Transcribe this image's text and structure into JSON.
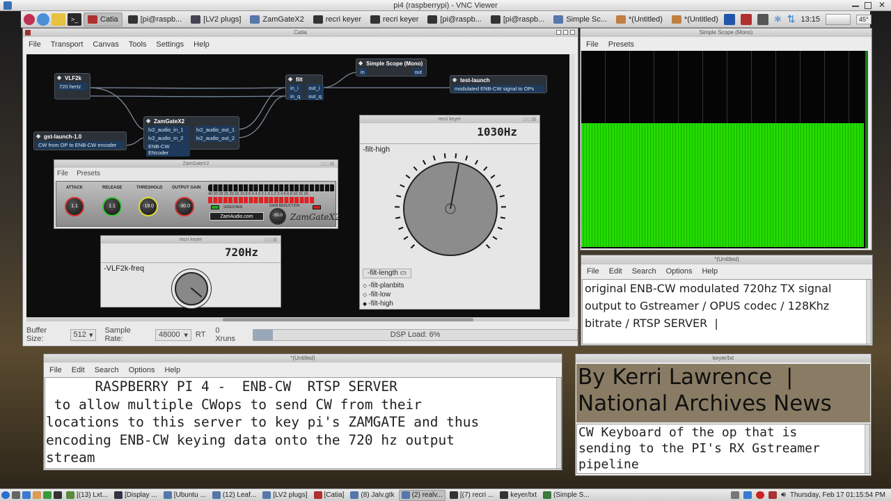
{
  "vnc_title": "pi4 (raspberrypi) - VNC Viewer",
  "top_taskbar": {
    "apps": [
      {
        "label": "Catia",
        "icon": "catia-icon",
        "color": "#b03030"
      },
      {
        "label": "[pi@raspb...",
        "icon": "terminal-icon",
        "color": "#333"
      },
      {
        "label": "[LV2 plugs]",
        "icon": "lv2-icon",
        "color": "#445"
      },
      {
        "label": "ZamGateX2",
        "icon": "window-icon",
        "color": "#5577aa"
      },
      {
        "label": "recri keyer",
        "icon": "app-icon",
        "color": "#333"
      },
      {
        "label": "recri keyer",
        "icon": "app-icon",
        "color": "#333"
      },
      {
        "label": "[pi@raspb...",
        "icon": "terminal-icon",
        "color": "#333"
      },
      {
        "label": "[pi@raspb...",
        "icon": "terminal-icon",
        "color": "#333"
      },
      {
        "label": "Simple Sc...",
        "icon": "window-icon",
        "color": "#5577aa"
      },
      {
        "label": "*(Untitled)",
        "icon": "pencil-icon",
        "color": "#c08040"
      },
      {
        "label": "*(Untitled)",
        "icon": "pencil-icon",
        "color": "#c08040"
      }
    ],
    "clock": "13:15",
    "cpu": "45°"
  },
  "catia": {
    "title": "Catia",
    "menu": [
      "File",
      "Transport",
      "Canvas",
      "Tools",
      "Settings",
      "Help"
    ],
    "nodes": {
      "vlf": {
        "title": "VLF2k",
        "port": "720 hertz"
      },
      "filt": {
        "title": "filt",
        "in_i": "in_i",
        "in_q": "in_q",
        "out_i": "out_i",
        "out_q": "out_q"
      },
      "scope": {
        "title": "Simple Scope (Mono)",
        "in": "in",
        "out": "out"
      },
      "test": {
        "title": "test-launch",
        "port": "modulated ENB-CW signal to OPs"
      },
      "zam": {
        "title": "ZamGateX2",
        "in1": "lv2_audio_in_1",
        "in2": "lv2_audio_in_2",
        "out1": "lv2_audio_out_1",
        "out2": "lv2_audio_out_2",
        "enc": "ENB-CW ENcoder"
      },
      "gst": {
        "title": "gst-launch-1.0",
        "port": "CW from OP to ENB-CW encoder"
      }
    },
    "status": {
      "buffer_label": "Buffer Size:",
      "buffer": "512",
      "rate_label": "Sample Rate:",
      "rate": "48000",
      "rt": "RT",
      "xruns": "0 Xruns",
      "dsp": "DSP Load: 6%",
      "dsp_level": 0.06
    }
  },
  "zamgate": {
    "title": "ZamGateX2",
    "menu": [
      "File",
      "Presets"
    ],
    "labels": [
      "ATTACK",
      "RELEASE",
      "THRESHOLD",
      "OUTPUT GAIN"
    ],
    "values": [
      "1.1",
      "1.1",
      "-19.0",
      "-30.0",
      "-50.0"
    ],
    "meter_scale": "40 30 28 25 20 15 10 8 6 5 4 3 2 1 0 1 2 3 4 5 6 8 10 15 20",
    "sidechain": "SIDECHAIN",
    "gain_red": "GAIN REDUCTION",
    "brand": "ZamAudio.com",
    "logo": "ZamGateX2",
    "knob_ticks": [
      "0.1",
      "500",
      "0.1",
      "500",
      "-60",
      "0",
      "-30",
      "30"
    ]
  },
  "keyer_small": {
    "title": "recri keyer",
    "freq": "720Hz",
    "param": "-VLF2k-freq"
  },
  "keyer_big": {
    "title": "recri keyer",
    "freq": "1030Hz",
    "param": "-filt-high",
    "select": "-filt-length",
    "options": [
      "-filt-planbits",
      "-filt-low",
      "-filt-high"
    ]
  },
  "scope_win": {
    "title": "Simple Scope (Mono)",
    "menu": [
      "File",
      "Presets"
    ]
  },
  "editor_top": {
    "title": "*(Untitled)",
    "menu": [
      "File",
      "Edit",
      "Search",
      "Options",
      "Help"
    ],
    "lines": [
      "original ENB-CW modulated 720hz TX signal",
      "output to Gstreamer / OPUS codec / 128Khz",
      "bitrate / RTSP SERVER  |"
    ]
  },
  "editor_main": {
    "title": "*(Untitled)",
    "menu": [
      "File",
      "Edit",
      "Search",
      "Options",
      "Help"
    ],
    "lines": [
      "      RASPBERRY PI 4 -  ENB-CW  RTSP SERVER",
      " to allow multiple CWops to send CW from their",
      "locations to this server to key pi's ZAMGATE and thus",
      "encoding ENB-CW keying data onto the 720 hz output",
      "stream"
    ]
  },
  "keyer_txt": {
    "title": "keyer/txt",
    "banner": [
      "By Kerri Lawrence  |",
      "National Archives News"
    ],
    "lines": [
      "CW Keyboard of the op that is",
      "sending to the PI's RX Gstreamer",
      "pipeline"
    ]
  },
  "bottom_taskbar": {
    "apps": [
      {
        "label": "[(13) Lxt...",
        "color": "#5a8a3a"
      },
      {
        "label": "[Display ...",
        "color": "#334"
      },
      {
        "label": "[Ubuntu ...",
        "color": "#5577aa"
      },
      {
        "label": "(12) Leaf...",
        "color": "#5577aa"
      },
      {
        "label": "[LV2 plugs]",
        "color": "#5577aa"
      },
      {
        "label": "[Catia]",
        "color": "#b03030"
      },
      {
        "label": "(8) Jalv.gtk",
        "color": "#5577aa"
      },
      {
        "label": "(2) realv...",
        "color": "#5577aa"
      },
      {
        "label": "[(7) recri ...",
        "color": "#333"
      },
      {
        "label": "keyer/txt",
        "color": "#333"
      },
      {
        "label": "(Simple S...",
        "color": "#3a7a3a"
      }
    ],
    "datetime": "Thursday, Feb 17 01:15:54 PM"
  },
  "colors": {
    "scope_green": "#22dd00",
    "scope_bg": "#050505",
    "node_bg": "#2c3138"
  }
}
